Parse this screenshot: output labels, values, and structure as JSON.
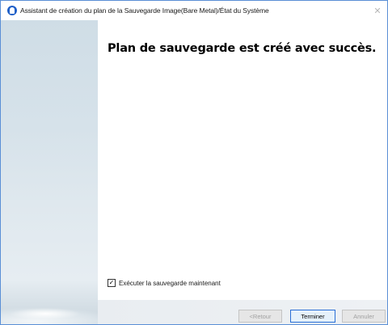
{
  "window": {
    "title": "Assistant de création du plan de la Sauvegarde Image(Bare Metal)/État du Système",
    "close_glyph": "✕"
  },
  "content": {
    "heading": "Plan de sauvegarde est créé avec succès.",
    "run_now_checkbox": {
      "label": "Exécuter la sauvegarde maintenant",
      "checked": true,
      "check_glyph": "✓"
    }
  },
  "footer": {
    "back_label": "<Retour",
    "finish_label": "Terminer",
    "cancel_label": "Annuler"
  },
  "colors": {
    "window_border": "#5a8fd6",
    "app_icon": "#1f5fc8",
    "primary_button_border": "#2a6fd6",
    "disabled_text": "#a0a0a0"
  },
  "icons": {
    "app": "app-logo-icon",
    "close": "close-icon",
    "checkbox": "checkbox-checked-icon"
  }
}
